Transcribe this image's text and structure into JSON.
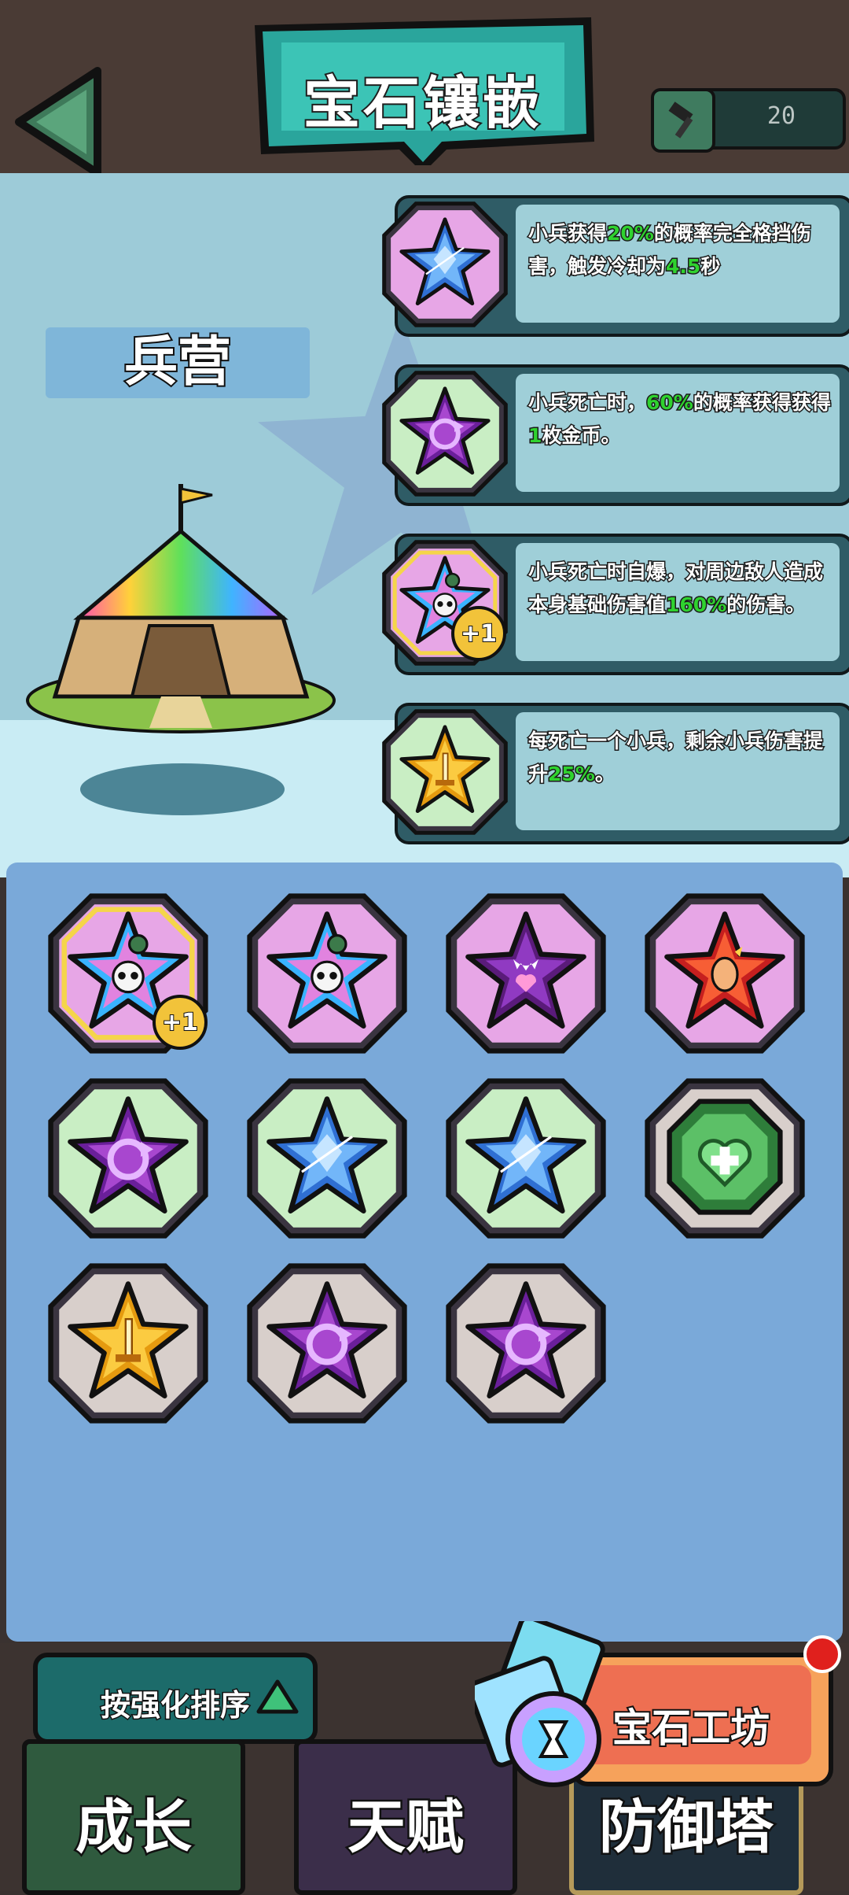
{
  "header": {
    "title": "宝石镶嵌",
    "hammer_count": "20"
  },
  "building": {
    "name": "兵营"
  },
  "skills": [
    {
      "icon": "blue-shield-star-gem",
      "frame": "pink",
      "text_parts": [
        "小兵获得",
        "20%",
        "的概率完全格挡伤害，触发冷却为",
        "4.5",
        "秒"
      ]
    },
    {
      "icon": "purple-recycle-star-gem",
      "frame": "green",
      "text_parts": [
        "小兵死亡时，",
        "60%",
        "的概率获得获得",
        "1",
        "枚金币。"
      ]
    },
    {
      "icon": "rainbow-skull-star-gem",
      "frame": "pink",
      "badge": "+1",
      "text_parts": [
        "小兵死亡时自爆，对周边敌人造成本身基础伤害值",
        "160%",
        "的伤害。"
      ]
    },
    {
      "icon": "gold-sword-star-gem",
      "frame": "green",
      "text_parts": [
        "每死亡一个小兵，剩余小兵伤害提升",
        "25%",
        "。"
      ]
    }
  ],
  "inventory": [
    {
      "icon": "rainbow-skull-star-gem",
      "frame": "pink",
      "badge": "+1",
      "selected": true
    },
    {
      "icon": "rainbow-skull-star-gem",
      "frame": "pink"
    },
    {
      "icon": "purple-fang-heart-star-gem",
      "frame": "pink"
    },
    {
      "icon": "red-rage-star-gem",
      "frame": "pink"
    },
    {
      "icon": "purple-recycle-star-gem",
      "frame": "green"
    },
    {
      "icon": "blue-shield-star-gem",
      "frame": "green"
    },
    {
      "icon": "blue-shield-star-gem",
      "frame": "green"
    },
    {
      "icon": "green-heal-octagon-gem",
      "frame": "gray"
    },
    {
      "icon": "gold-sword-star-gem",
      "frame": "gray"
    },
    {
      "icon": "purple-recycle-star-gem",
      "frame": "gray"
    },
    {
      "icon": "purple-recycle-star-gem",
      "frame": "gray"
    }
  ],
  "controls": {
    "sort_label": "按强化排序",
    "workshop_label": "宝石工坊"
  },
  "tabs": [
    {
      "label": "成长",
      "color": "#2f5a3e"
    },
    {
      "label": "天赋",
      "color": "#3b2e4a"
    },
    {
      "label": "防御塔",
      "color": "#1f2e3a"
    }
  ],
  "colors": {
    "frame_pink": "#e7a6e6",
    "frame_green": "#c9eec4",
    "frame_gray": "#d8cfcb",
    "highlight_green": "#2fd22f",
    "panel_teal": "#2f5c66",
    "inventory_bg": "#7aa9d9"
  }
}
